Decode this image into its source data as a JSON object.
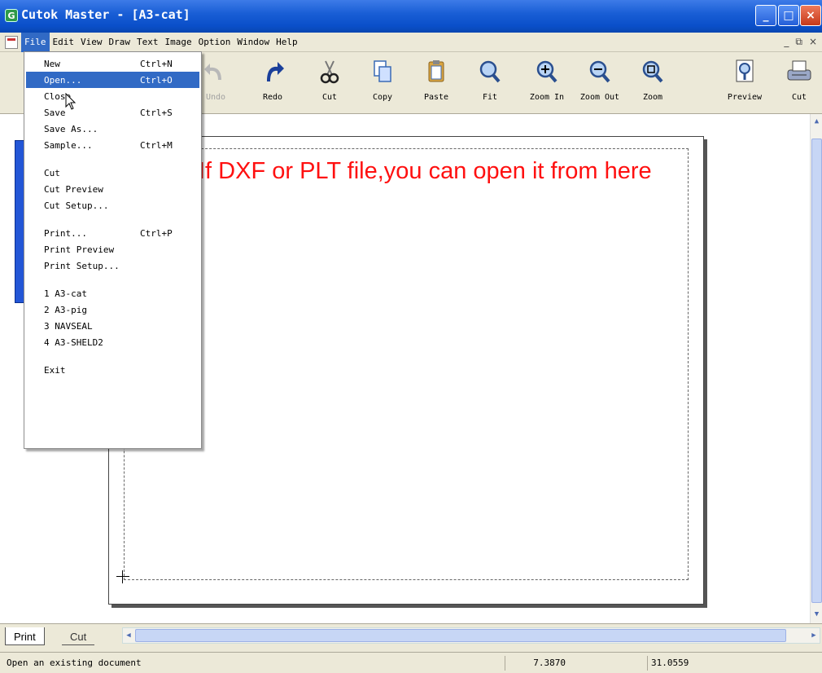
{
  "window": {
    "title": "Cutok Master - [A3-cat]",
    "app_icon": "cutok-app-icon",
    "buttons": {
      "minimize": "_",
      "maximize": "□",
      "close": "×"
    },
    "mdi_controls": [
      "_",
      "⧉",
      "×"
    ]
  },
  "menubar": {
    "items": [
      "File",
      "Edit",
      "View",
      "Draw",
      "Text",
      "Image",
      "Option",
      "Window",
      "Help"
    ],
    "active": "File"
  },
  "toolbar": {
    "buttons": [
      {
        "label": "Undo",
        "icon": "undo-icon",
        "enabled": false
      },
      {
        "label": "Redo",
        "icon": "redo-icon",
        "enabled": true
      },
      {
        "label": "Cut",
        "icon": "scissors-icon",
        "enabled": true
      },
      {
        "label": "Copy",
        "icon": "copy-icon",
        "enabled": true
      },
      {
        "label": "Paste",
        "icon": "paste-icon",
        "enabled": true
      },
      {
        "label": "Fit",
        "icon": "zoom-fit-icon",
        "enabled": true
      },
      {
        "label": "Zoom In",
        "icon": "zoom-in-icon",
        "enabled": true
      },
      {
        "label": "Zoom Out",
        "icon": "zoom-out-icon",
        "enabled": true
      },
      {
        "label": "Zoom",
        "icon": "zoom-icon",
        "enabled": true
      },
      {
        "label": "Preview",
        "icon": "preview-icon",
        "enabled": true
      },
      {
        "label": "Cut",
        "icon": "plotter-cut-icon",
        "enabled": true
      }
    ]
  },
  "file_menu": {
    "items": [
      {
        "label": "New",
        "shortcut": "Ctrl+N"
      },
      {
        "label": "Open...",
        "shortcut": "Ctrl+O",
        "highlighted": true
      },
      {
        "label": "Close",
        "shortcut": ""
      },
      {
        "label": "Save",
        "shortcut": "Ctrl+S"
      },
      {
        "label": "Save As...",
        "shortcut": ""
      },
      {
        "label": "Sample...",
        "shortcut": "Ctrl+M"
      },
      {
        "label": "Cut",
        "shortcut": ""
      },
      {
        "label": "Cut Preview",
        "shortcut": ""
      },
      {
        "label": "Cut Setup...",
        "shortcut": ""
      },
      {
        "label": "Print...",
        "shortcut": "Ctrl+P"
      },
      {
        "label": "Print Preview",
        "shortcut": ""
      },
      {
        "label": "Print Setup...",
        "shortcut": ""
      },
      {
        "label": "1 A3-cat",
        "shortcut": ""
      },
      {
        "label": "2 A3-pig",
        "shortcut": ""
      },
      {
        "label": "3 NAVSEAL",
        "shortcut": ""
      },
      {
        "label": "4 A3-SHELD2",
        "shortcut": ""
      },
      {
        "label": "Exit",
        "shortcut": ""
      }
    ]
  },
  "annotation": {
    "text": "If DXF or PLT file,you can open it from here",
    "color": "#ff1010"
  },
  "tabs": [
    "Print",
    "Cut"
  ],
  "active_tab": "Print",
  "status": {
    "message": "Open an existing document",
    "x_coord": "7.3870",
    "y_coord": "31.0559"
  }
}
